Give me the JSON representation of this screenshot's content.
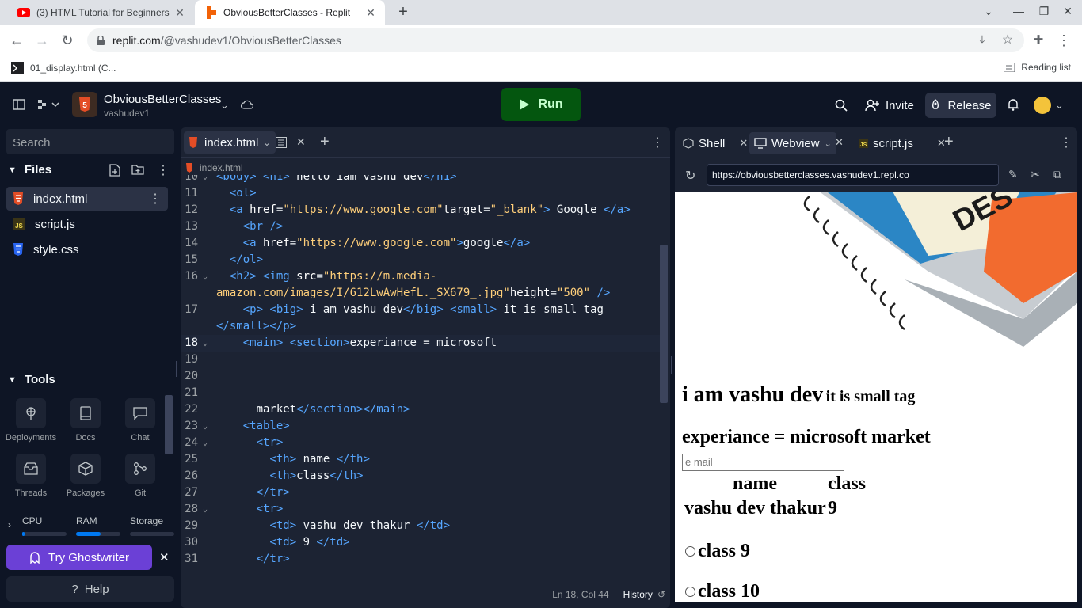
{
  "browser": {
    "tabs": [
      {
        "title": "(3) HTML Tutorial for Beginners |",
        "icon": "youtube-icon",
        "active": false
      },
      {
        "title": "ObviousBetterClasses - Replit",
        "icon": "replit-icon",
        "active": true
      }
    ],
    "url_host": "replit.com",
    "url_path": "/@vashudev1/ObviousBetterClasses",
    "bookmark": "01_display.html (C...",
    "reading_list": "Reading list"
  },
  "replit": {
    "repl_name": "ObviousBetterClasses",
    "owner": "vashudev1",
    "run_label": "Run",
    "invite_label": "Invite",
    "release_label": "Release"
  },
  "sidebar": {
    "search_placeholder": "Search",
    "files_title": "Files",
    "files": [
      {
        "name": "index.html",
        "type": "html"
      },
      {
        "name": "script.js",
        "type": "js"
      },
      {
        "name": "style.css",
        "type": "css"
      }
    ],
    "tools_title": "Tools",
    "tools": [
      {
        "label": "Deployments",
        "icon": "deployments-icon"
      },
      {
        "label": "Docs",
        "icon": "docs-icon"
      },
      {
        "label": "Chat",
        "icon": "chat-icon"
      },
      {
        "label": "Threads",
        "icon": "threads-icon"
      },
      {
        "label": "Packages",
        "icon": "packages-icon"
      },
      {
        "label": "Git",
        "icon": "git-icon"
      }
    ],
    "resources": {
      "cpu": "CPU",
      "ram": "RAM",
      "storage": "Storage",
      "cpu_level": 0.05,
      "ram_level": 0.55,
      "storage_level": 0.0
    },
    "ghostwriter": "Try Ghostwriter",
    "help": "Help"
  },
  "editor": {
    "tab": "index.html",
    "breadcrumb": "index.html",
    "cursor": "Ln 18, Col 44",
    "history": "History",
    "lines": [
      {
        "n": "10",
        "fold": true,
        "html": "<span class=\"tg\">&lt;body&gt;</span> <span class=\"tg\">&lt;h1&gt;</span> hello iam vashu dev<span class=\"tg\">&lt;/h1&gt;</span>"
      },
      {
        "n": "11",
        "html": "  <span class=\"tg\">&lt;ol&gt;</span>"
      },
      {
        "n": "12",
        "html": "  <span class=\"tg\">&lt;a</span> <span class=\"at\">href</span>=<span class=\"st\">\"https://www.google.com\"</span><span class=\"at\">target</span>=<span class=\"st\">\"_blank\"</span><span class=\"tg\">&gt;</span> Google <span class=\"tg\">&lt;/a&gt;</span>"
      },
      {
        "n": "13",
        "html": "    <span class=\"tg\">&lt;br /&gt;</span>"
      },
      {
        "n": "14",
        "html": "    <span class=\"tg\">&lt;a</span> <span class=\"at\">href</span>=<span class=\"st\">\"https://www.google.com\"</span><span class=\"tg\">&gt;</span>google<span class=\"tg\">&lt;/a&gt;</span>"
      },
      {
        "n": "15",
        "html": "  <span class=\"tg\">&lt;/ol&gt;</span>"
      },
      {
        "n": "16",
        "fold": true,
        "html": "  <span class=\"tg\">&lt;h2&gt;</span> <span class=\"tg\">&lt;img</span> <span class=\"at\">src</span>=<span class=\"st\">\"https://m.media-</span>"
      },
      {
        "n": "",
        "html": "<span class=\"st\">amazon.com/images/I/612LwAwHefL._SX679_.jpg\"</span><span class=\"at\">height</span>=<span class=\"st\">\"500\"</span> <span class=\"tg\">/&gt;</span>"
      },
      {
        "n": "17",
        "html": "    <span class=\"tg\">&lt;p&gt;</span> <span class=\"tg\">&lt;big&gt;</span> i am vashu dev<span class=\"tg\">&lt;/big&gt;</span> <span class=\"tg\">&lt;small&gt;</span> it is small tag"
      },
      {
        "n": "",
        "html": "<span class=\"tg\">&lt;/small&gt;&lt;/p&gt;</span>"
      },
      {
        "n": "18",
        "fold": true,
        "cur": true,
        "html": "    <span class=\"tg\">&lt;main&gt;</span> <span class=\"tg\">&lt;section&gt;</span>experiance = microsoft"
      },
      {
        "n": "19",
        "html": ""
      },
      {
        "n": "20",
        "html": ""
      },
      {
        "n": "21",
        "html": ""
      },
      {
        "n": "22",
        "html": "      market<span class=\"tg\">&lt;/section&gt;&lt;/main&gt;</span>"
      },
      {
        "n": "23",
        "fold": true,
        "html": "    <span class=\"tg\">&lt;table&gt;</span>"
      },
      {
        "n": "24",
        "fold": true,
        "html": "      <span class=\"tg\">&lt;tr&gt;</span>"
      },
      {
        "n": "25",
        "html": "        <span class=\"tg\">&lt;th&gt;</span> name <span class=\"tg\">&lt;/th&gt;</span>"
      },
      {
        "n": "26",
        "html": "        <span class=\"tg\">&lt;th&gt;</span>class<span class=\"tg\">&lt;/th&gt;</span>"
      },
      {
        "n": "27",
        "html": "      <span class=\"tg\">&lt;/tr&gt;</span>"
      },
      {
        "n": "28",
        "fold": true,
        "html": "      <span class=\"tg\">&lt;tr&gt;</span>"
      },
      {
        "n": "29",
        "html": "        <span class=\"tg\">&lt;td&gt;</span> vashu dev thakur <span class=\"tg\">&lt;/td&gt;</span>"
      },
      {
        "n": "30",
        "html": "        <span class=\"tg\">&lt;td&gt;</span> 9 <span class=\"tg\">&lt;/td&gt;</span>"
      },
      {
        "n": "31",
        "html": "      <span class=\"tg\">&lt;/tr&gt;</span>"
      }
    ]
  },
  "rightpane": {
    "tabs": [
      {
        "label": "Shell",
        "icon": "shell-icon"
      },
      {
        "label": "Webview",
        "icon": "monitor-icon"
      },
      {
        "label": "script.js",
        "icon": "js-icon"
      }
    ],
    "address": "https://obviousbetterclasses.vashudev1.repl.co",
    "webview": {
      "p_big": "i am vashu dev",
      "p_small": "it is small tag",
      "section": "experiance = microsoft market",
      "input_placeholder": "e mail",
      "th_name": "name",
      "th_class": "class",
      "td_name": "vashu dev thakur",
      "td_class": "9",
      "radio1": "class 9",
      "radio2": "class 10"
    }
  },
  "colors": {
    "replit_bg": "#0e1525",
    "panel": "#1c2333",
    "run": "#04560f",
    "ghostwriter": "#6b40d6",
    "html_orange": "#e44d26",
    "js_yellow": "#f0db4f",
    "css_blue": "#2965f1"
  }
}
